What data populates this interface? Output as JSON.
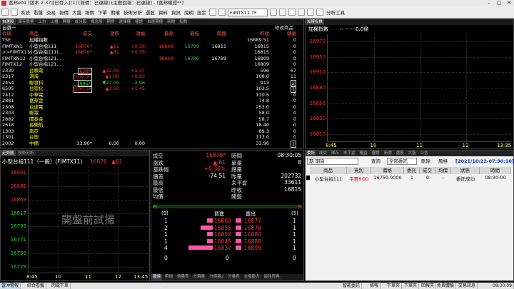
{
  "app": {
    "title": "富邦e01 [版本 2.37][已登入][1] [報價：已連線] [主動回報：已連線] - [富邦權證**]"
  },
  "menu": {
    "items": [
      "系統",
      "看盤",
      "交易",
      "報價",
      "大盤",
      "報價",
      "下單",
      "期權",
      "技術分析",
      "選股",
      "資料",
      "資訊",
      "說明",
      "設定"
    ],
    "symbol": "FIMTX11.TF",
    "analysis": "分析工具"
  },
  "quote": {
    "tabs": [
      "自選股",
      "庫存股票",
      "上市",
      "上櫃",
      "興櫃",
      "成分股",
      "概念股",
      "期貨",
      "選擇權",
      "權證",
      "自選期權",
      "新聞",
      "指數"
    ],
    "filter_label": "修改商品",
    "group": "自選一",
    "headers": [
      "代碼",
      "商品",
      "成交",
      "漲跌",
      "漲幅",
      "最高",
      "最低",
      "開盤",
      "昨收",
      "總量"
    ],
    "rows": [
      {
        "code": "TSE",
        "name": "加權指數",
        "price": "",
        "chg": "",
        "pct": "",
        "high": "",
        "low": "",
        "open": "",
        "prev": "16889.51",
        "vol": "0",
        "dir": "flat"
      },
      {
        "code": "FIMTXN1",
        "name": "小型台指111",
        "price": "16876*",
        "chg": "▲61",
        "pct": "+0.36",
        "high": "16898",
        "low": "16799",
        "open": "16811",
        "prev": "16815",
        "vol": "0",
        "dir": "up"
      },
      {
        "code": ">>FIMTX11",
        "name": "小型台指111(...",
        "price": "16876*",
        "chg": "▲61",
        "pct": "+0.36",
        "high": "",
        "low": "",
        "open": "",
        "prev": "16815",
        "vol": "0",
        "dir": "up"
      },
      {
        "code": "FIMTXN12",
        "name": "小型台指121...",
        "price": "",
        "chg": "",
        "pct": "",
        "high": "16868",
        "low": "16780",
        "open": "16789",
        "prev": "16809",
        "vol": "0",
        "dir": "flat"
      },
      {
        "code": "FIMTX12",
        "name": "小型台指121...",
        "price": "",
        "chg": "",
        "pct": "",
        "high": "",
        "low": "",
        "open": "",
        "prev": "16809",
        "vol": "0",
        "dir": "flat"
      },
      {
        "code": "2330",
        "name": "台積電",
        "price": "628*",
        "chg": "▲32.00",
        "pct": "+5.37",
        "high": "",
        "low": "",
        "open": "",
        "prev": "596",
        "vol": "67",
        "dir": "up"
      },
      {
        "code": "2317",
        "name": "鴻海",
        "price": "109.0*",
        "chg": "▲1.00",
        "pct": "+0.93",
        "high": "",
        "low": "",
        "open": "",
        "prev": "108.0",
        "vol": "11",
        "dir": "up"
      },
      {
        "code": "2454",
        "name": "聯發科",
        "price": "886*",
        "chg": "▼27.00",
        "pct": "-2.96",
        "high": "",
        "low": "",
        "open": "",
        "prev": "913",
        "vol": "2",
        "dir": "down"
      },
      {
        "code": "6505",
        "name": "台塑化",
        "price": "105.0*",
        "chg": "▲1.50",
        "pct": "+1.45",
        "high": "",
        "low": "",
        "open": "",
        "prev": "103.5",
        "vol": "1",
        "dir": "up"
      },
      {
        "code": "2412",
        "name": "中華電",
        "price": "",
        "chg": "",
        "pct": "",
        "high": "",
        "low": "",
        "open": "",
        "prev": "110.5",
        "vol": "0",
        "dir": "flat"
      },
      {
        "code": "2881",
        "name": "富邦金",
        "price": "",
        "chg": "",
        "pct": "",
        "high": "",
        "low": "",
        "open": "",
        "prev": "74.8",
        "vol": "0",
        "dir": "flat"
      },
      {
        "code": "2308",
        "name": "台達電",
        "price": "",
        "chg": "",
        "pct": "",
        "high": "",
        "low": "",
        "open": "",
        "prev": "253.0",
        "vol": "0",
        "dir": "flat"
      },
      {
        "code": "2303",
        "name": "聯電",
        "price": "",
        "chg": "",
        "pct": "",
        "high": "",
        "low": "",
        "open": "",
        "prev": "58.0",
        "vol": "0",
        "dir": "flat"
      },
      {
        "code": "2882",
        "name": "國泰金",
        "price": "",
        "chg": "",
        "pct": "",
        "high": "",
        "low": "",
        "open": "",
        "prev": "58.7",
        "vol": "0",
        "dir": "flat"
      },
      {
        "code": "2618",
        "name": "長榮航",
        "price": "",
        "chg": "",
        "pct": "",
        "high": "",
        "low": "",
        "open": "",
        "prev": "18.40",
        "vol": "0",
        "dir": "flat"
      },
      {
        "code": "1303",
        "name": "南亞",
        "price": "",
        "chg": "",
        "pct": "",
        "high": "",
        "low": "",
        "open": "",
        "prev": "89.3",
        "vol": "0",
        "dir": "flat"
      },
      {
        "code": "1301",
        "name": "台塑",
        "price": "",
        "chg": "",
        "pct": "",
        "high": "",
        "low": "",
        "open": "",
        "prev": "113.0",
        "vol": "0",
        "dir": "flat"
      },
      {
        "code": "2002",
        "name": "中鋼",
        "price": "33.90*",
        "chg": "0.00",
        "pct": "0.00",
        "high": "",
        "low": "",
        "open": "",
        "prev": "33.90",
        "vol": "1",
        "dir": "flat"
      }
    ]
  },
  "index_panel": {
    "tab": "加權指數",
    "title": "加權指數",
    "values": "-- -- -- 0.0億",
    "y_ticks": [
      "16970",
      "16950",
      "16910",
      "16880",
      "16850",
      "16830",
      "16810"
    ],
    "x_ticks": [
      "8:45",
      "10",
      "11",
      "12",
      "13:35"
    ]
  },
  "tick_panel": {
    "tabs": [
      "走勢圖",
      "技術分析"
    ],
    "title": "小型台指111（一般）(FIMTX11)",
    "price": "16876",
    "chg": "▲61",
    "y_ticks": [
      "16901",
      "16881",
      "16859",
      "16817",
      "16793",
      "16771",
      "16759",
      "16729"
    ],
    "x_ticks": [
      "8:45",
      "10",
      "11",
      "12",
      "13:45"
    ],
    "watermark": "開盤前試撮",
    "bottom_tabs": [
      "報價",
      "明細",
      "價量表",
      "分價量",
      "分價量2",
      "分量表",
      "支撐壓力",
      "最佳買賣"
    ]
  },
  "detail": {
    "left": [
      {
        "label": "成交",
        "value": "16876*",
        "color": "red"
      },
      {
        "label": "漲跌",
        "value": "▲ 61",
        "color": "red"
      },
      {
        "label": "漲跌幅",
        "value": "+0.36%",
        "color": "red"
      },
      {
        "label": "價差",
        "value": "-74.51",
        "color": "wht"
      },
      {
        "label": "最高",
        "value": "",
        "color": "wht"
      },
      {
        "label": "最低",
        "value": "",
        "color": "wht"
      },
      {
        "label": "均價",
        "value": "",
        "color": "wht"
      }
    ],
    "right": [
      {
        "label": "時間",
        "value": "08:30:05",
        "color": "wht"
      },
      {
        "label": "單量",
        "value": "8",
        "color": "wht"
      },
      {
        "label": "總量",
        "value": "",
        "color": "wht"
      },
      {
        "label": "昨量",
        "value": "202732",
        "color": "wht"
      },
      {
        "label": "未平倉",
        "value": "33611",
        "color": "wht"
      },
      {
        "label": "昨收",
        "value": "16815",
        "color": "wht"
      },
      {
        "label": "開盤",
        "value": "",
        "color": "wht"
      }
    ],
    "inner_label": "內",
    "outer_label": "外",
    "bid_total": "(9)",
    "ask_total": "(5)",
    "bid_header": "買進",
    "ask_header": "賣出",
    "book": [
      {
        "bq": "1",
        "bid": "16860",
        "ask": "16877",
        "aq": "1",
        "bw": 0.25
      },
      {
        "bq": "2",
        "bid": "16856",
        "ask": "16878",
        "aq": "1",
        "bw": 0.5
      },
      {
        "bq": "1",
        "bid": "16852",
        "ask": "16880",
        "aq": "1",
        "bw": 0.25
      },
      {
        "bq": "1",
        "bid": "16845",
        "ask": "16888",
        "aq": "1",
        "bw": 0.25
      },
      {
        "bq": "4",
        "bid": "16837",
        "ask": "16898",
        "aq": "1",
        "bw": 1.0
      }
    ],
    "footer": [
      "0",
      "0",
      "0"
    ]
  },
  "order": {
    "tabs": [
      "委託",
      "成交",
      "庫存",
      "未平倉",
      "權益",
      "權證",
      "新聞",
      "選股",
      "大盤",
      "公告"
    ],
    "account": "期 期貨",
    "query": "查詢",
    "type": "全部委託",
    "delete": "刪除",
    "refresh": "風格",
    "time": "[2021/10/22-07:30:10]",
    "headers": [
      "商品",
      "買別",
      "價格",
      "委託",
      "成交",
      "均價",
      "狀態",
      "時間"
    ],
    "row": {
      "name": "小型台指111",
      "side": "平賣ROD",
      "price": "16750.0000",
      "qty": "1",
      "filled": "0",
      "avg": "--",
      "status": "委託成功",
      "time": "08:30:00"
    }
  },
  "status": {
    "items": [
      "當沖警報",
      "綜合看盤",
      "閃電下單",
      "智能委託",
      "條報",
      "下單夾",
      "下單夾",
      "回報夾",
      "免費體驗",
      "交易訊息",
      "08:30:09"
    ]
  }
}
